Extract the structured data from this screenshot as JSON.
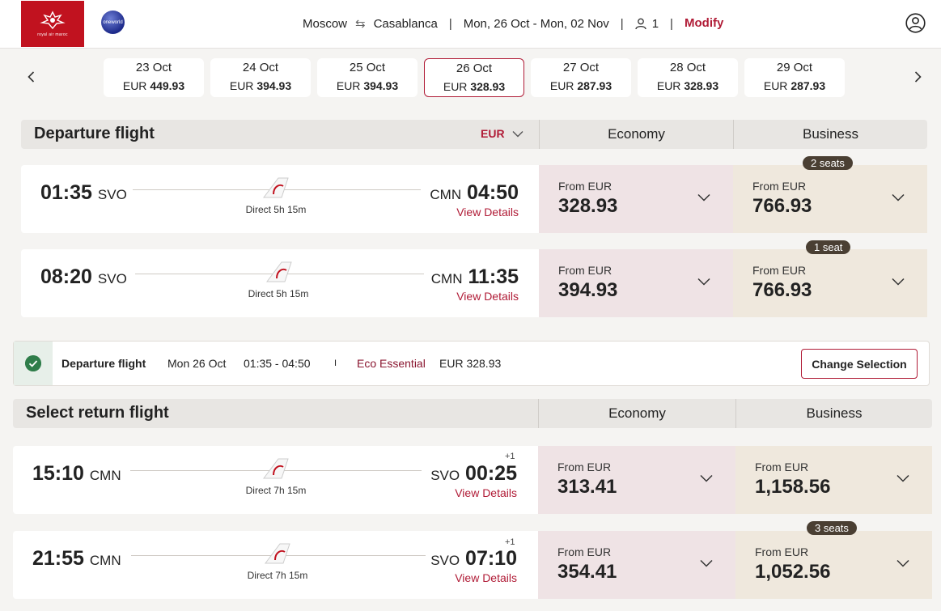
{
  "header": {
    "airline_logo_text": "royal air maroc",
    "alliance_logo_text": "oneworld",
    "origin": "Moscow",
    "destination": "Casablanca",
    "dates": "Mon, 26 Oct - Mon, 02 Nov",
    "passengers": "1",
    "modify_label": "Modify",
    "icons": [
      "swap-icon",
      "passenger-icon",
      "account-icon"
    ]
  },
  "date_strip": [
    {
      "date": "23 Oct",
      "currency": "EUR",
      "price": "449.93",
      "selected": false
    },
    {
      "date": "24 Oct",
      "currency": "EUR",
      "price": "394.93",
      "selected": false
    },
    {
      "date": "25 Oct",
      "currency": "EUR",
      "price": "394.93",
      "selected": false
    },
    {
      "date": "26 Oct",
      "currency": "EUR",
      "price": "328.93",
      "selected": true
    },
    {
      "date": "27 Oct",
      "currency": "EUR",
      "price": "287.93",
      "selected": false
    },
    {
      "date": "28 Oct",
      "currency": "EUR",
      "price": "328.93",
      "selected": false
    },
    {
      "date": "29 Oct",
      "currency": "EUR",
      "price": "287.93",
      "selected": false
    }
  ],
  "departure_section": {
    "title": "Departure flight",
    "currency_selector": "EUR",
    "col_economy": "Economy",
    "col_business": "Business",
    "flights": [
      {
        "dep_time": "01:35",
        "dep_code": "SVO",
        "arr_time": "04:50",
        "arr_code": "CMN",
        "plus_day": "",
        "duration": "Direct 5h 15m",
        "details": "View Details",
        "eco_from": "From EUR",
        "eco_price": "328.93",
        "bus_from": "From EUR",
        "bus_price": "766.93",
        "bus_seats": "2 seats"
      },
      {
        "dep_time": "08:20",
        "dep_code": "SVO",
        "arr_time": "11:35",
        "arr_code": "CMN",
        "plus_day": "",
        "duration": "Direct 5h 15m",
        "details": "View Details",
        "eco_from": "From EUR",
        "eco_price": "394.93",
        "bus_from": "From EUR",
        "bus_price": "766.93",
        "bus_seats": "1 seat"
      }
    ]
  },
  "selected_departure": {
    "label": "Departure flight",
    "date": "Mon 26 Oct",
    "times": "01:35 - 04:50",
    "divider": "I",
    "fare_family": "Eco Essential",
    "price": "EUR 328.93",
    "change_label": "Change Selection"
  },
  "return_section": {
    "title": "Select return flight",
    "col_economy": "Economy",
    "col_business": "Business",
    "flights": [
      {
        "dep_time": "15:10",
        "dep_code": "CMN",
        "arr_time": "00:25",
        "arr_code": "SVO",
        "plus_day": "+1",
        "duration": "Direct 7h 15m",
        "details": "View Details",
        "eco_from": "From EUR",
        "eco_price": "313.41",
        "bus_from": "From EUR",
        "bus_price": "1,158.56",
        "bus_seats": ""
      },
      {
        "dep_time": "21:55",
        "dep_code": "CMN",
        "arr_time": "07:10",
        "arr_code": "SVO",
        "plus_day": "+1",
        "duration": "Direct 7h 15m",
        "details": "View Details",
        "eco_from": "From EUR",
        "eco_price": "354.41",
        "bus_from": "From EUR",
        "bus_price": "1,052.56",
        "bus_seats": "3 seats"
      }
    ]
  },
  "colors": {
    "brand_red": "#b01b36",
    "logo_red": "#c1121f",
    "economy_bg": "#efe3e5",
    "business_bg": "#efe8dd",
    "seat_badge": "#4a3f33",
    "check_green": "#2f7d4a"
  }
}
